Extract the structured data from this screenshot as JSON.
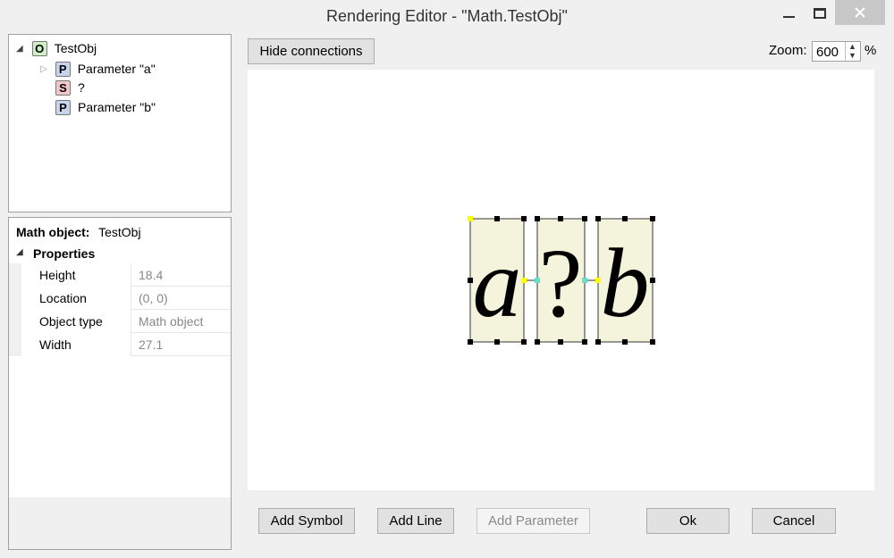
{
  "window": {
    "title": "Rendering Editor - \"Math.TestObj\""
  },
  "tree": {
    "root": {
      "badge": "O",
      "label": "TestObj"
    },
    "children": [
      {
        "badge": "P",
        "label": "Parameter \"a\"",
        "expandable": true
      },
      {
        "badge": "S",
        "label": "?"
      },
      {
        "badge": "P",
        "label": "Parameter \"b\""
      }
    ]
  },
  "properties": {
    "header_label": "Math object:",
    "header_value": "TestObj",
    "category": "Properties",
    "rows": [
      {
        "name": "Height",
        "value": "18.4"
      },
      {
        "name": "Location",
        "value": "(0, 0)"
      },
      {
        "name": "Object type",
        "value": "Math object"
      },
      {
        "name": "Width",
        "value": "27.1"
      }
    ]
  },
  "toolbar": {
    "hide_connections": "Hide connections",
    "zoom_label": "Zoom:",
    "zoom_value": "600",
    "zoom_unit": "%"
  },
  "canvas": {
    "glyphs": [
      "a",
      "?",
      "b"
    ],
    "box_fill": "#f4f4dc",
    "handle_color": "#000000",
    "anchor_color": "#ffff00",
    "connector_color": "#66e0c8"
  },
  "footer": {
    "add_symbol": "Add Symbol",
    "add_line": "Add Line",
    "add_parameter": "Add Parameter",
    "ok": "Ok",
    "cancel": "Cancel"
  }
}
